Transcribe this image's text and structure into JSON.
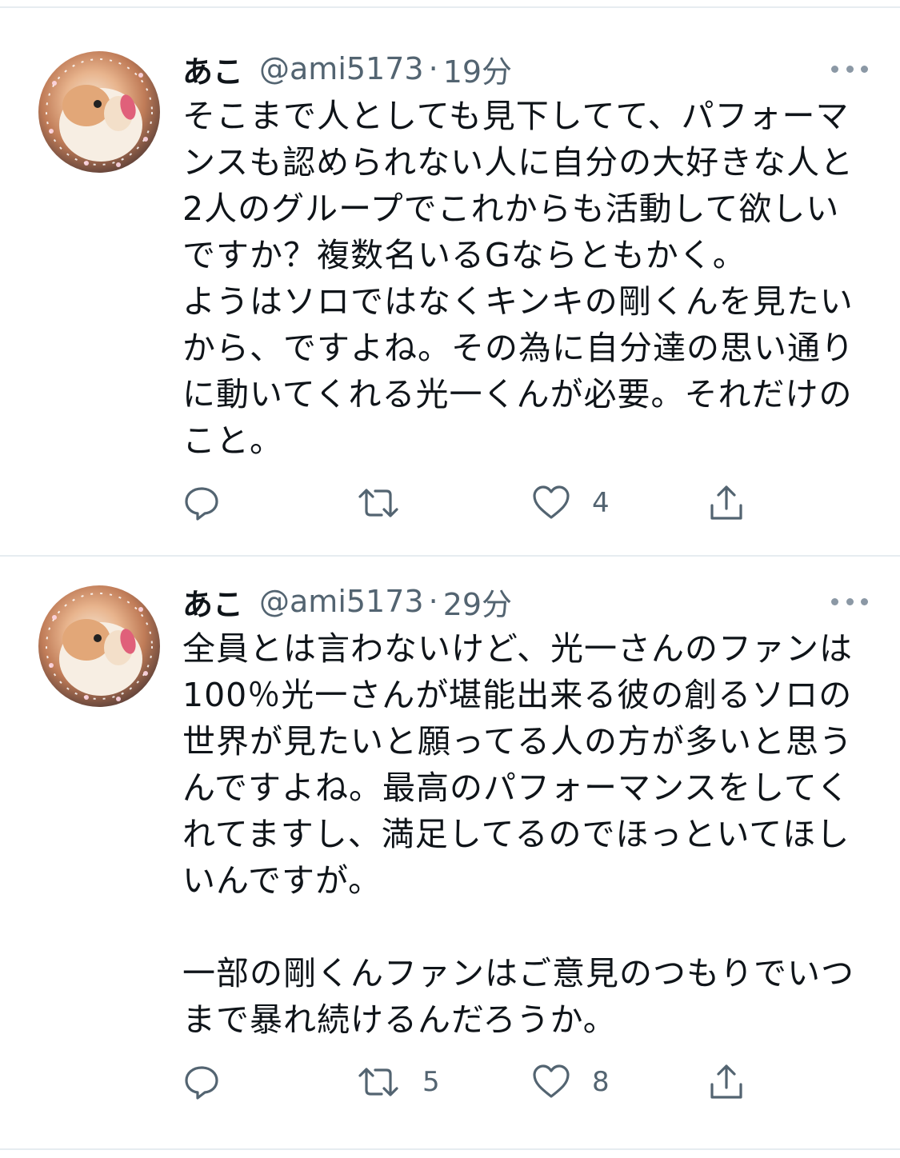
{
  "tweets": [
    {
      "name": "あこ",
      "handle": "@ami5173",
      "separator": "·",
      "time": "19分",
      "text": "そこまで人としても見下してて、パフォーマンスも認められない人に自分の大好きな人と2人のグループでこれからも活動して欲しいですか？複数名いるGならともかく。\nようはソロではなくキンキの剛くんを見たいから、ですよね。その為に自分達の思い通りに動いてくれる光一くんが必要。それだけのこと。",
      "reply_count": "",
      "retweet_count": "",
      "like_count": "4"
    },
    {
      "name": "あこ",
      "handle": "@ami5173",
      "separator": "·",
      "time": "29分",
      "text": "全員とは言わないけど、光一さんのファンは100％光一さんが堪能出来る彼の創るソロの世界が見たいと願ってる人の方が多いと思うんですよね。最高のパフォーマンスをしてくれてますし、満足してるのでほっといてほしいんですが。\n\n一部の剛くんファンはご意見のつもりでいつまで暴れ続けるんだろうか。",
      "reply_count": "",
      "retweet_count": "5",
      "like_count": "8"
    }
  ],
  "icons": {
    "reply": "reply-icon",
    "retweet": "retweet-icon",
    "like": "heart-icon",
    "share": "share-icon",
    "more": "more-icon"
  },
  "colors": {
    "text": "#0f1419",
    "secondary": "#536471",
    "divider": "#e6ecf0"
  }
}
